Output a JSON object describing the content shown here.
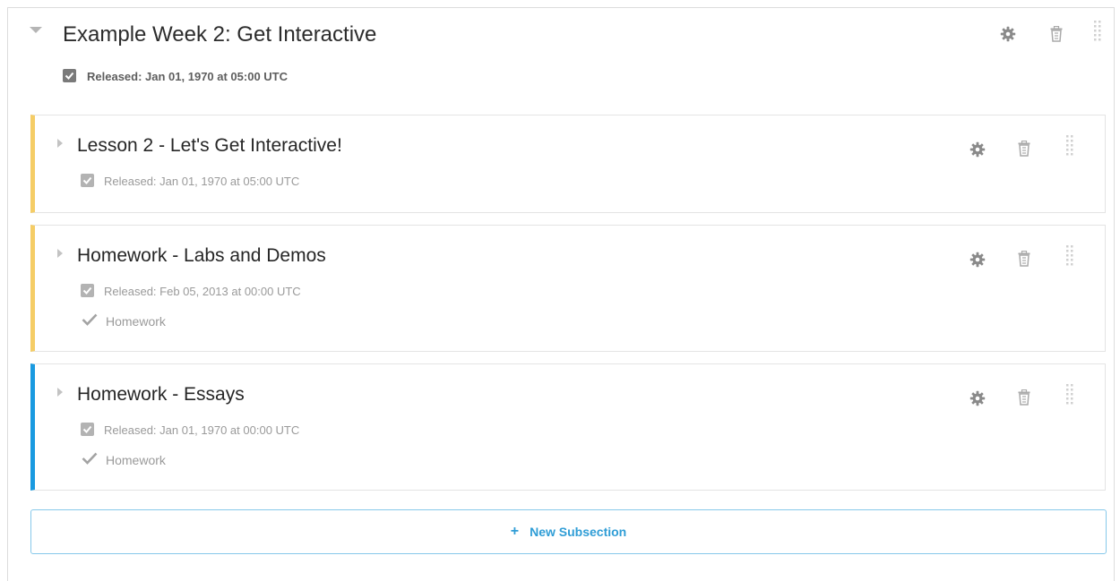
{
  "section": {
    "title": "Example Week 2: Get Interactive",
    "release": "Released: Jan 01, 1970 at 05:00 UTC",
    "icons": {
      "toggle": "triangle-down-icon",
      "settings": "gear-icon",
      "delete": "trash-icon",
      "drag": "drag-handle-icon"
    }
  },
  "subsections": [
    {
      "title": "Lesson 2 - Let's Get Interactive!",
      "release": "Released: Jan 01, 1970 at 05:00 UTC",
      "grading": "",
      "accent": "#f5cd66"
    },
    {
      "title": "Homework - Labs and Demos",
      "release": "Released: Feb 05, 2013 at 00:00 UTC",
      "grading": "Homework",
      "accent": "#f5cd66"
    },
    {
      "title": "Homework - Essays",
      "release": "Released: Jan 01, 1970 at 00:00 UTC",
      "grading": "Homework",
      "accent": "#1a9ae0"
    }
  ],
  "new_subsection": {
    "icon": "+",
    "label": "New Subsection"
  },
  "colors": {
    "accent_blue": "#2f9dd6",
    "border_blue": "#86c8ea",
    "accent_yellow": "#f5cd66"
  }
}
